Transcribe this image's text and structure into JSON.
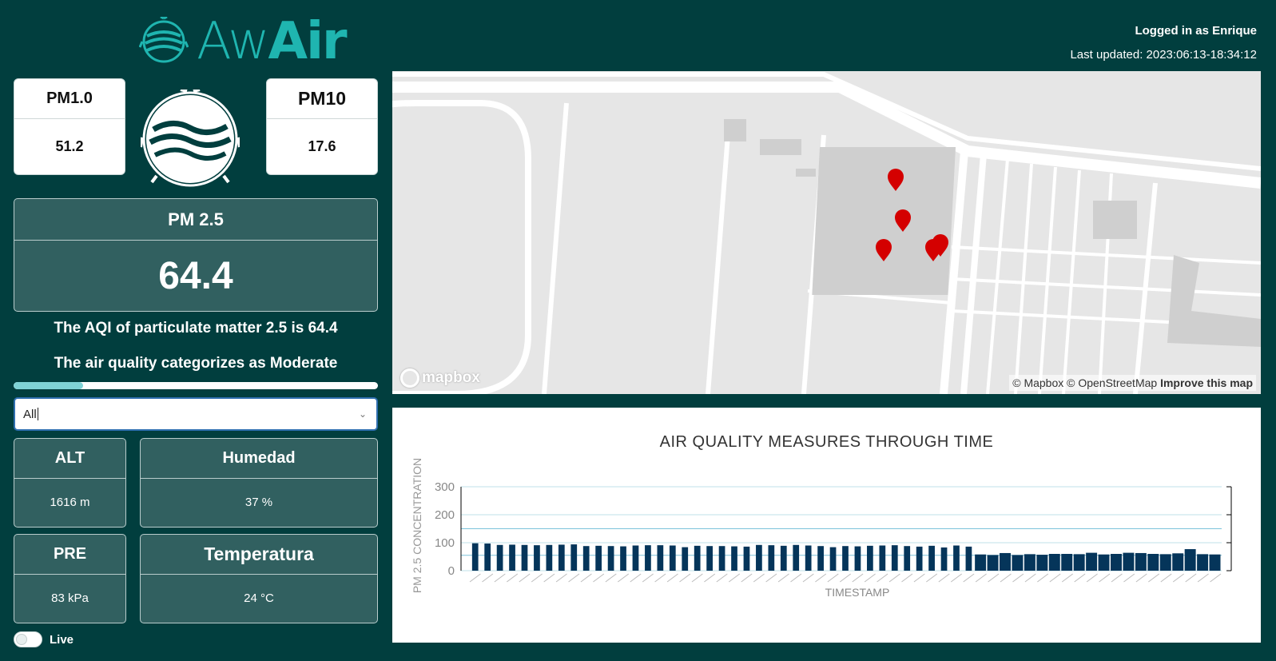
{
  "brand": {
    "part1": "Aw",
    "part2": "Air"
  },
  "header": {
    "user": "Logged in as Enrique",
    "updated": "Last updated: 2023:06:13-18:34:12"
  },
  "pm1": {
    "label": "PM1.0",
    "value": "51.2"
  },
  "pm10": {
    "label": "PM10",
    "value": "17.6"
  },
  "pm25": {
    "label": "PM 2.5",
    "value": "64.4"
  },
  "aqi": {
    "line1": "The AQI of particulate matter 2.5 is 64.4",
    "line2": "The air quality categorizes as Moderate",
    "progress": 0.19
  },
  "filter": {
    "value": "All"
  },
  "sensors": {
    "alt": {
      "label": "ALT",
      "value": "1616 m"
    },
    "humidity": {
      "label": "Humedad",
      "value": "37 %"
    },
    "pressure": {
      "label": "PRE",
      "value": "83 kPa"
    },
    "temperature": {
      "label": "Temperatura",
      "value": "24 °C"
    }
  },
  "live": {
    "label": "Live",
    "on": false
  },
  "map": {
    "logo": "mapbox",
    "attribution": "© Mapbox © OpenStreetMap",
    "improve": "Improve this map",
    "marker_color": "#d40000"
  },
  "chart_data": {
    "type": "bar",
    "title": "AIR QUALITY MEASURES THROUGH TIME",
    "xlabel": "TIMESTAMP",
    "ylabel": "PM 2.5 CONCENTRATION",
    "ylim": [
      0,
      300
    ],
    "yticks": [
      "0",
      "100",
      "200",
      "300"
    ],
    "reference_lines": [
      55,
      150
    ],
    "bar_color": "#05355a",
    "values": [
      98,
      97,
      92,
      93,
      92,
      91,
      92,
      93,
      94,
      88,
      89,
      88,
      87,
      90,
      91,
      91,
      90,
      84,
      89,
      88,
      88,
      87,
      86,
      92,
      91,
      89,
      92,
      90,
      88,
      84,
      88,
      87,
      89,
      90,
      91,
      88,
      86,
      89,
      83,
      90,
      86,
      58,
      56,
      63,
      56,
      59,
      57,
      60,
      60,
      59,
      64,
      58,
      60,
      64,
      63,
      60,
      59,
      62,
      77,
      59,
      58
    ]
  }
}
